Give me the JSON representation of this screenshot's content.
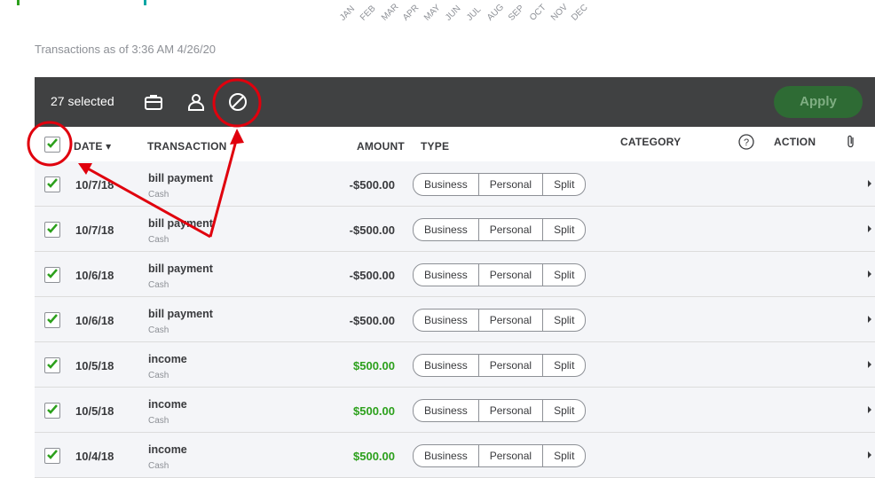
{
  "top": {
    "months": [
      "JAN",
      "FEB",
      "MAR",
      "APR",
      "MAY",
      "JUN",
      "JUL",
      "AUG",
      "SEP",
      "OCT",
      "NOV",
      "DEC"
    ]
  },
  "as_of_text": "Transactions as of 3:36 AM 4/26/20",
  "toolbar": {
    "selected_text": "27 selected",
    "apply_label": "Apply",
    "icons": [
      "briefcase-icon",
      "person-icon",
      "exclude-icon"
    ]
  },
  "columns": {
    "date": "DATE ▾",
    "transaction": "TRANSACTION",
    "amount": "AMOUNT",
    "type": "TYPE",
    "category": "CATEGORY",
    "action": "ACTION"
  },
  "type_options": [
    "Business",
    "Personal",
    "Split"
  ],
  "colors": {
    "toolbar_bg": "#404142",
    "apply_bg": "#2e6b34",
    "check_green": "#2ca01c",
    "income_green": "#2ca01c",
    "annotation_red": "#e0000d"
  },
  "rows": [
    {
      "date": "10/7/18",
      "name": "bill payment",
      "account": "Cash",
      "amount": "-$500.00",
      "income": false
    },
    {
      "date": "10/7/18",
      "name": "bill payment",
      "account": "Cash",
      "amount": "-$500.00",
      "income": false
    },
    {
      "date": "10/6/18",
      "name": "bill payment",
      "account": "Cash",
      "amount": "-$500.00",
      "income": false
    },
    {
      "date": "10/6/18",
      "name": "bill payment",
      "account": "Cash",
      "amount": "-$500.00",
      "income": false
    },
    {
      "date": "10/5/18",
      "name": "income",
      "account": "Cash",
      "amount": "$500.00",
      "income": true
    },
    {
      "date": "10/5/18",
      "name": "income",
      "account": "Cash",
      "amount": "$500.00",
      "income": true
    },
    {
      "date": "10/4/18",
      "name": "income",
      "account": "Cash",
      "amount": "$500.00",
      "income": true
    }
  ]
}
